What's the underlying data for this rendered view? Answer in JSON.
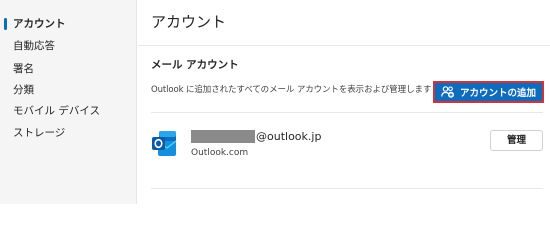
{
  "sidebar": {
    "items": [
      {
        "label": "アカウント",
        "active": true
      },
      {
        "label": "自動応答",
        "active": false
      },
      {
        "label": "署名",
        "active": false
      },
      {
        "label": "分類",
        "active": false
      },
      {
        "label": "モバイル デバイス",
        "active": false
      },
      {
        "label": "ストレージ",
        "active": false
      }
    ]
  },
  "main": {
    "title": "アカウント",
    "section_title": "メール アカウント",
    "section_description": "Outlook に追加されたすべてのメール アカウントを表示および管理します",
    "add_account_label": "アカウントの追加",
    "accounts": [
      {
        "email_suffix": "@outlook.jp",
        "type": "Outlook.com",
        "manage_label": "管理"
      }
    ]
  },
  "colors": {
    "accent": "#0f6cbd",
    "highlight_border": "#d13438",
    "sidebar_bg": "#f5f5f5",
    "redaction": "#8a8a8a"
  },
  "icons": {
    "add_account": "people-add-icon",
    "account": "outlook-logo-icon"
  }
}
